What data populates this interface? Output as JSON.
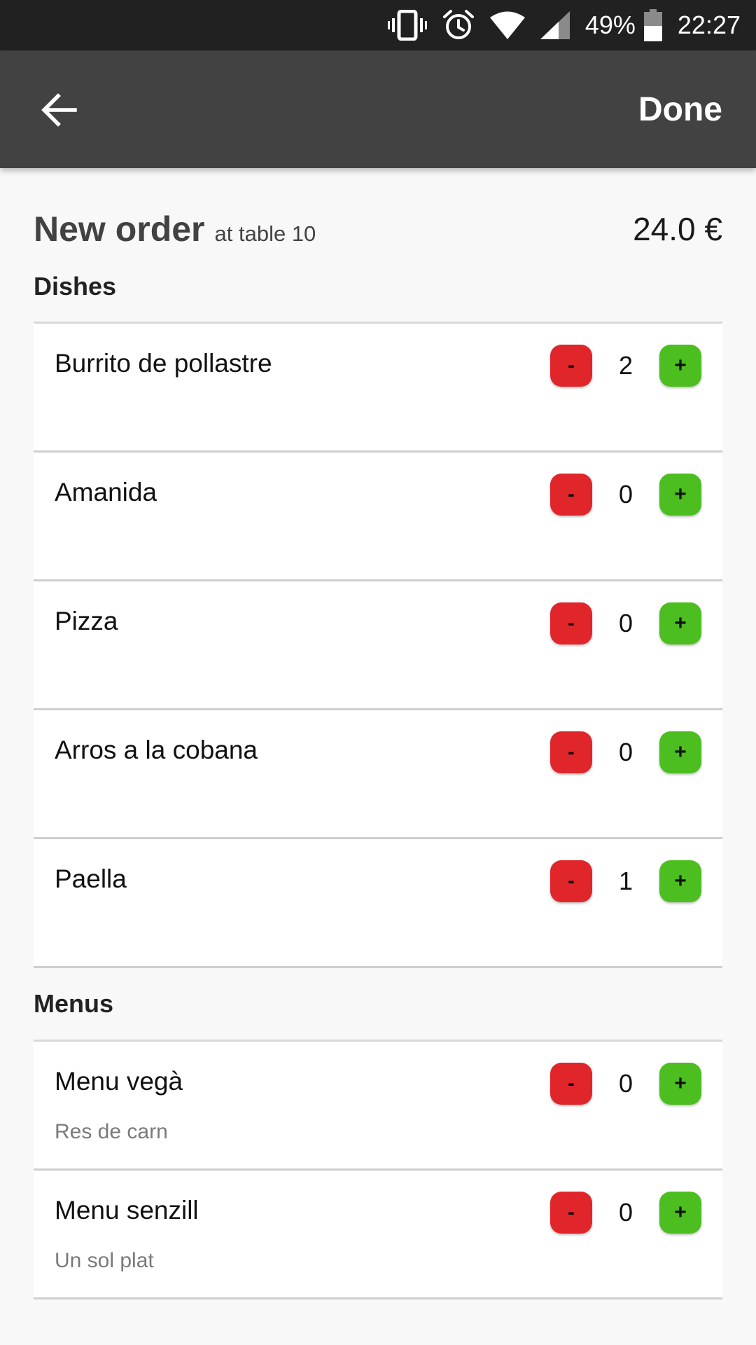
{
  "status_bar": {
    "battery": "49%",
    "time": "22:27",
    "icons": [
      "vibrate-icon",
      "alarm-icon",
      "wifi-icon",
      "signal-icon",
      "battery-icon"
    ]
  },
  "toolbar": {
    "back_icon": "arrow-left-icon",
    "done_label": "Done"
  },
  "order": {
    "title": "New order",
    "subtitle": "at table 10",
    "total": "24.0 €"
  },
  "dishes": {
    "title": "Dishes",
    "items": [
      {
        "name": "Burrito de pollastre",
        "qty": "2"
      },
      {
        "name": "Amanida",
        "qty": "0"
      },
      {
        "name": "Pizza",
        "qty": "0"
      },
      {
        "name": "Arros a la cobana",
        "qty": "0"
      },
      {
        "name": "Paella",
        "qty": "1"
      }
    ]
  },
  "menus": {
    "title": "Menus",
    "items": [
      {
        "name": "Menu vegà",
        "desc": "Res de carn",
        "qty": "0"
      },
      {
        "name": "Menu senzill",
        "desc": "Un sol plat",
        "qty": "0"
      }
    ]
  },
  "stepper": {
    "minus_label": "-",
    "plus_label": "+"
  },
  "colors": {
    "status_bar": "#212121",
    "toolbar": "#424242",
    "minus": "#e0262b",
    "plus": "#4cbe1f",
    "background": "#f8f8f8"
  }
}
